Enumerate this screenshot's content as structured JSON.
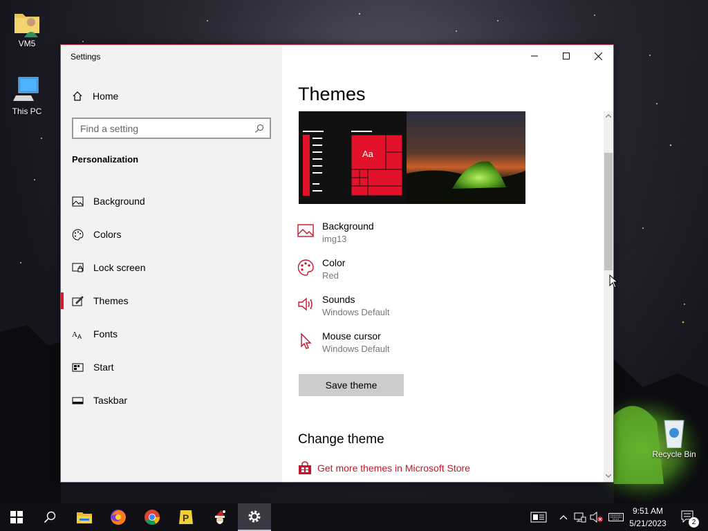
{
  "desktop": {
    "icons": [
      {
        "label": "VM5",
        "icon": "user-folder-icon"
      },
      {
        "label": "This PC",
        "icon": "computer-icon"
      },
      {
        "label": "Recycle Bin",
        "icon": "recycle-bin-icon"
      }
    ]
  },
  "window": {
    "title": "Settings",
    "controls": [
      "minimize",
      "maximize",
      "close"
    ]
  },
  "nav": {
    "home_label": "Home",
    "search_placeholder": "Find a setting",
    "section_title": "Personalization",
    "items": [
      {
        "label": "Background",
        "icon": "picture-icon"
      },
      {
        "label": "Colors",
        "icon": "palette-icon"
      },
      {
        "label": "Lock screen",
        "icon": "lock-screen-icon"
      },
      {
        "label": "Themes",
        "icon": "brush-icon",
        "active": true
      },
      {
        "label": "Fonts",
        "icon": "fonts-icon"
      },
      {
        "label": "Start",
        "icon": "start-icon"
      },
      {
        "label": "Taskbar",
        "icon": "taskbar-icon"
      }
    ]
  },
  "content": {
    "title": "Themes",
    "preview_tile_text": "Aa",
    "properties": [
      {
        "name": "Background",
        "value": "img13",
        "icon": "picture-icon"
      },
      {
        "name": "Color",
        "value": "Red",
        "icon": "palette-icon"
      },
      {
        "name": "Sounds",
        "value": "Windows Default",
        "icon": "speaker-icon"
      },
      {
        "name": "Mouse cursor",
        "value": "Windows Default",
        "icon": "cursor-icon"
      }
    ],
    "save_button": "Save theme",
    "change_theme_title": "Change theme",
    "store_link": "Get more themes in Microsoft Store"
  },
  "taskbar": {
    "apps": [
      "start-icon",
      "search-icon",
      "file-explorer-icon",
      "firefox-icon",
      "chrome-icon",
      "app-p-icon",
      "santa-icon",
      "settings-icon"
    ],
    "active_app": "settings-icon",
    "time": "9:51 AM",
    "date": "5/21/2023",
    "notification_count": "2"
  },
  "colors": {
    "accent": "#d41a30",
    "window_border": "#d9304a",
    "link": "#c8142a"
  }
}
